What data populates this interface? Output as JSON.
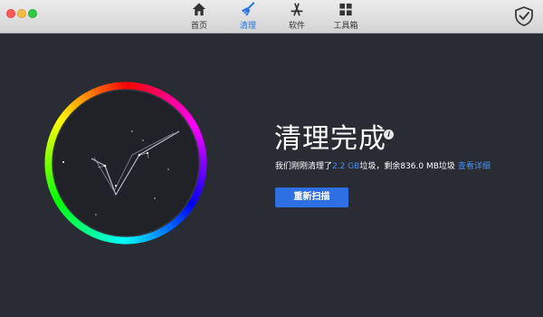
{
  "window": {
    "colors": {
      "close": "#fc5753",
      "minimize": "#fdbc40",
      "zoom": "#33c748"
    }
  },
  "toolbar": {
    "tabs": [
      {
        "label": "首页",
        "icon": "home-icon",
        "active": false
      },
      {
        "label": "清理",
        "icon": "broom-icon",
        "active": true
      },
      {
        "label": "软件",
        "icon": "app-store-icon",
        "active": false
      },
      {
        "label": "工具箱",
        "icon": "grid-icon",
        "active": false
      }
    ],
    "right_icon": "shield-check-icon",
    "active_color": "#2a72e0"
  },
  "main": {
    "ring_icon": "checkmark-constellation-icon",
    "heading": "清理完成",
    "info_icon": "info-icon",
    "summary_prefix": "我们刚刚清理了",
    "summary_cleaned": "2.2 GB",
    "summary_middle": "垃圾，剩余836.0 MB垃圾",
    "view_details_link": "查看详细",
    "rescan_button": "重新扫描",
    "accent_color": "#2e6fe4"
  }
}
